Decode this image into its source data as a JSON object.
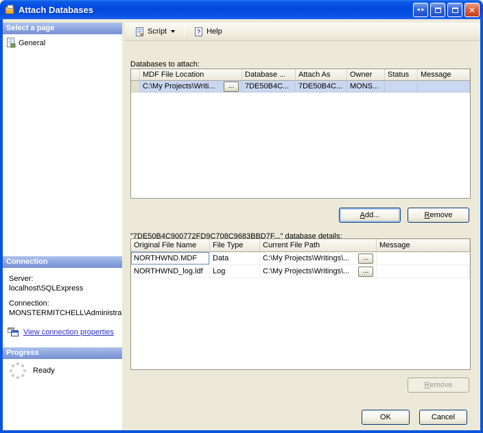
{
  "window": {
    "title": "Attach Databases",
    "controls": {
      "close_glyph": "✕",
      "dock_glyph": "◄►"
    }
  },
  "colors": {
    "titlebar_blue": "#0349DF",
    "section_header_blue": "#8BA4DE",
    "selection_blue": "#C9D7F0",
    "link_blue": "#2B2BC8",
    "close_red": "#DD5F3B",
    "background_tan": "#ECE9D8"
  },
  "sidebar": {
    "select_page_header": "Select a page",
    "pages": [
      {
        "label": "General"
      }
    ],
    "connection_header": "Connection",
    "server_label": "Server:",
    "server_value": "localhost\\SQLExpress",
    "connection_label": "Connection:",
    "connection_value": "MONSTERMITCHELL\\Administra",
    "view_connection_link": "View connection properties",
    "progress_header": "Progress",
    "progress_status": "Ready"
  },
  "toolbar": {
    "script_label": "Script",
    "help_label": "Help"
  },
  "main": {
    "databases_label": "Databases to attach:",
    "browse_label": "...",
    "grid1": {
      "columns": [
        "MDF File Location",
        "Database ...",
        "Attach As",
        "Owner",
        "Status",
        "Message"
      ],
      "rows": [
        {
          "mdf": "C:\\My Projects\\Writi...",
          "database": "7DE50B4C...",
          "attach_as": "7DE50B4C...",
          "owner": "MONS...",
          "status": "",
          "message": ""
        }
      ]
    },
    "add_button": "Add...",
    "remove_button": "Remove",
    "details_label": "\"7DE50B4C900772FD9C708C9683BBD7F...\" database details:",
    "grid2": {
      "columns": [
        "Original File Name",
        "File Type",
        "Current File Path",
        "Message"
      ],
      "rows": [
        {
          "name": "NORTHWND.MDF",
          "type": "Data",
          "path": "C:\\My Projects\\Writings\\...",
          "message": ""
        },
        {
          "name": "NORTHWND_log.ldf",
          "type": "Log",
          "path": "C:\\My Projects\\Writings\\...",
          "message": ""
        }
      ]
    },
    "details_remove_button": "Remove",
    "ok_button": "OK",
    "cancel_button": "Cancel"
  }
}
